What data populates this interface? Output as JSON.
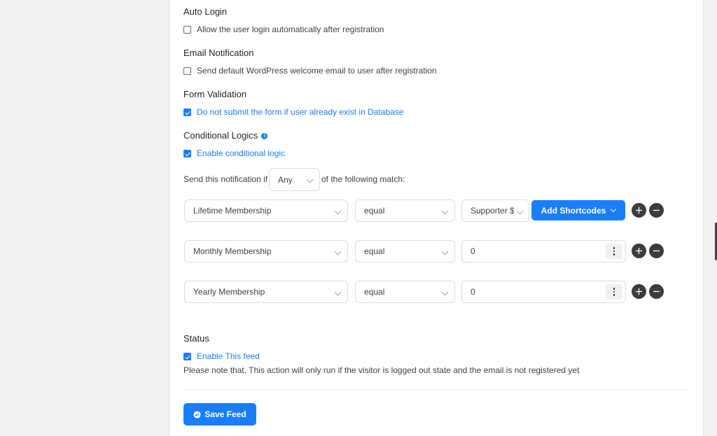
{
  "sections": {
    "auto_login": {
      "title": "Auto Login",
      "label": "Allow the user login automatically after registration"
    },
    "email_notification": {
      "title": "Email Notification",
      "label": "Send default WordPress welcome email to user after registration"
    },
    "form_validation": {
      "title": "Form Validation",
      "label": "Do not submit the form if user already exist in Database"
    },
    "conditional_logics": {
      "title": "Conditional Logics",
      "info_icon": "info-icon",
      "label": "Enable conditional logic"
    }
  },
  "send_row": {
    "prefix": "Send this notification if",
    "match_value": "Any",
    "suffix": "of the following match:"
  },
  "conditions": [
    {
      "field": "Lifetime Membership",
      "operator": "equal",
      "value": "Supporter $"
    },
    {
      "field": "Monthly Membership",
      "operator": "equal",
      "value": "0"
    },
    {
      "field": "Yearly Membership",
      "operator": "equal",
      "value": "0"
    }
  ],
  "add_shortcodes_label": "Add Shortcodes",
  "status": {
    "title": "Status",
    "label": "Enable This feed",
    "note": "Please note that, This action will only run if the visitor is logged out state and the email is not registered yet"
  },
  "save_button": {
    "label": "Save Feed",
    "icon": "check-circle-icon"
  },
  "colors": {
    "accent": "#1a7efb",
    "circle_button": "#3c3c3c"
  }
}
